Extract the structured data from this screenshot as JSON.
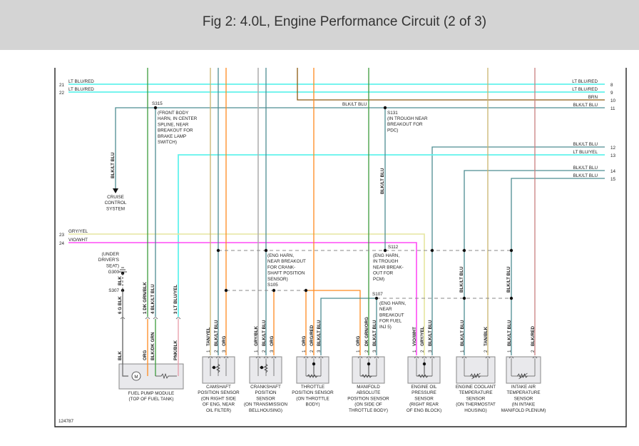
{
  "title": "Fig 2: 4.0L, Engine Performance Circuit (2 of 3)",
  "figure_id": "124787",
  "colors": {
    "lt_blu": "#62f2ec",
    "blk_lt_blu": "#4d8d92",
    "brn": "#8b5a10",
    "orange": "#ff8a1f",
    "green": "#3c9c3c",
    "tan": "#c9b46e",
    "gray": "#b0b0b0",
    "vio_wht": "#ff4cf5",
    "gry_yel": "#e6e6a0",
    "pnk": "#e79aa8",
    "red": "#c98080",
    "dashed": "#888888"
  },
  "left_connector": [
    {
      "pin": "21",
      "wire": "LT BLU/RED"
    },
    {
      "pin": "22",
      "wire": "LT BLU/RED"
    },
    {
      "pin": "23",
      "wire": "GRY/YEL"
    },
    {
      "pin": "24",
      "wire": "VIO/WHT"
    }
  ],
  "right_connector": [
    {
      "pin": "8",
      "wire": "LT BLU/RED"
    },
    {
      "pin": "9",
      "wire": "LT BLU/RED"
    },
    {
      "pin": "10",
      "wire": "BRN"
    },
    {
      "pin": "11",
      "wire": "BLK/LT BLU"
    },
    {
      "pin": "12",
      "wire": "BLK/LT BLU"
    },
    {
      "pin": "13",
      "wire": "LT BLU/YEL"
    },
    {
      "pin": "14",
      "wire": "BLK/LT BLU"
    },
    {
      "pin": "15",
      "wire": "BLK/LT BLU"
    }
  ],
  "inline_labels": {
    "wire_11_mid": "BLK/LT BLU",
    "cruise_wire": "BLK/LT BLU",
    "s131_wire": "BLK/LT BLU",
    "s112_ect_wire": "BLK/LT BLU",
    "s112_iat_wire": "BLK/LT BLU",
    "ground_wire": "BLK"
  },
  "cruise_control": [
    "CRUISE",
    "CONTROL",
    "SYSTEM"
  ],
  "splices": {
    "s315": {
      "id": "S315",
      "note": [
        "(FRONT BODY",
        "HARN, IN CENTER",
        "SPLINE, NEAR",
        "BREAKOUT FOR",
        "BRAKE LAMP",
        "SWITCH)"
      ]
    },
    "s131": {
      "id": "S131",
      "note": [
        "(IN TROUGH NEAR",
        "BREAKOUT FOR",
        "PDC)"
      ]
    },
    "s112": {
      "id": "S112",
      "note": [
        "(ENG HARN,",
        "IN TROUGH",
        "NEAR BREAK-",
        "OUT FOR",
        "PCM)"
      ]
    },
    "s105": {
      "id": "S105",
      "note": [
        "(ENG HARN,",
        "NEAR BREAKOUT",
        "FOR CRANK-",
        "SHAFT POSITION",
        "SENSOR)"
      ]
    },
    "s107": {
      "id": "S107",
      "note": [
        "(ENG HARN,",
        "NEAR",
        "BREAKOUT",
        "FOR FUEL",
        "INJ 5)"
      ]
    },
    "s307": {
      "id": "S307"
    },
    "g300": {
      "id": "G300",
      "note": [
        "(UNDER",
        "DRIVER'S",
        "SEAT)"
      ]
    }
  },
  "components": [
    {
      "key": "fuel_pump",
      "label": [
        "FUEL PUMP MODULE",
        "(TOP OF FUEL TANK)"
      ],
      "pins": [
        {
          "n": "6",
          "wire": "G BLK",
          "inner": "BLK"
        },
        {
          "n": "1",
          "wire": "DK GRN/BLK",
          "inner": "ORG"
        },
        {
          "n": "4",
          "wire": "BLK/LT BLU",
          "inner": "BLK/DK GRN"
        },
        {
          "n": "3",
          "wire": "LT BLU/YEL",
          "inner": "PNK/BLK"
        }
      ]
    },
    {
      "key": "cmp",
      "label": [
        "CAMSHAFT",
        "POSITION SENSOR",
        "(ON RIGHT SIDE",
        "OF ENG, NEAR",
        "OIL FILTER)"
      ],
      "pins": [
        {
          "n": "1",
          "wire": "TAN/YEL"
        },
        {
          "n": "2",
          "wire": "BLK/LT BLU"
        },
        {
          "n": "3",
          "wire": "ORG"
        }
      ]
    },
    {
      "key": "ckp",
      "label": [
        "CRANKSHAFT",
        "POSITION",
        "SENSOR",
        "(ON TRANSMISSION",
        "BELLHOUSING)"
      ],
      "pins": [
        {
          "n": "1",
          "wire": "GRY/BLK"
        },
        {
          "n": "2",
          "wire": "BLK/LT BLU"
        },
        {
          "n": "3",
          "wire": "ORG"
        }
      ]
    },
    {
      "key": "tps",
      "label": [
        "THROTTLE",
        "POSITION SENSOR",
        "(ON THROTTLE",
        "BODY)"
      ],
      "pins": [
        {
          "n": "1",
          "wire": "ORG"
        },
        {
          "n": "2",
          "wire": "ORG/RED"
        },
        {
          "n": "3",
          "wire": "BLK/LT BLU"
        }
      ]
    },
    {
      "key": "map",
      "label": [
        "MANIFOLD",
        "ABSOLUTE",
        "POSITION SENSOR",
        "(ON SIDE OF",
        "THROTTLE BODY)"
      ],
      "pins": [
        {
          "n": "1",
          "wire": "ORG"
        },
        {
          "n": "2",
          "wire": "DK GRN/ORG"
        },
        {
          "n": "3",
          "wire": "BLK/LT BLU"
        }
      ]
    },
    {
      "key": "oil",
      "label": [
        "ENGINE OIL",
        "PRESSURE",
        "SENSOR",
        "(RIGHT REAR",
        "OF ENG BLOCK)"
      ],
      "pins": [
        {
          "n": "1",
          "wire": "VIO/WHT"
        },
        {
          "n": "2",
          "wire": "GRY/YEL"
        },
        {
          "n": "3",
          "wire": "BLK/LT BLU"
        }
      ]
    },
    {
      "key": "ect",
      "label": [
        "ENGINE COOLANT",
        "TEMPERATURE",
        "SENSOR",
        "(ON THERMOSTAT",
        "HOUSING)"
      ],
      "pins": [
        {
          "n": "1",
          "wire": "BLK/LT BLU"
        },
        {
          "n": "2",
          "wire": "TAN/BLK"
        }
      ]
    },
    {
      "key": "iat",
      "label": [
        "INTAKE AIR",
        "TEMPERATURE",
        "SENSOR",
        "(IN INTAKE",
        "MANIFOLD PLENUM)"
      ],
      "pins": [
        {
          "n": "1",
          "wire": "BLK/LT BLU"
        },
        {
          "n": "2",
          "wire": "BLK/RED"
        }
      ]
    }
  ]
}
